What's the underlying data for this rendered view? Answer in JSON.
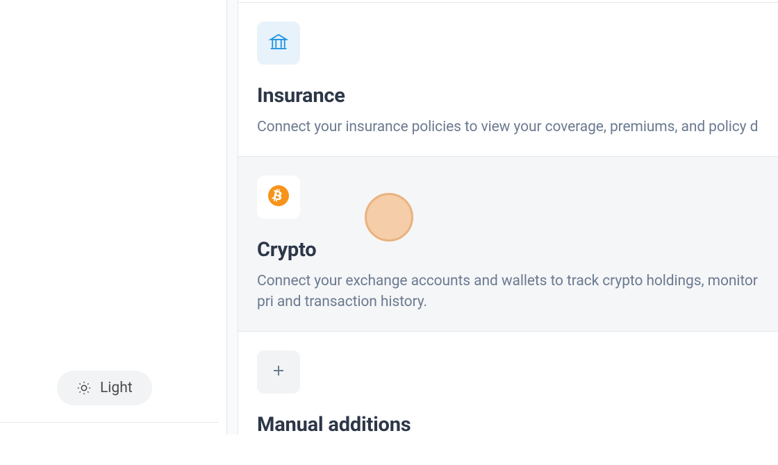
{
  "sidebar": {
    "theme_label": "Light"
  },
  "cards": [
    {
      "title": "Insurance",
      "description": "Connect your insurance policies to view your coverage, premiums, and policy deta"
    },
    {
      "title": "Crypto",
      "description": "Connect your exchange accounts and wallets to track crypto holdings, monitor pri and transaction history."
    },
    {
      "title": "Manual additions",
      "description": ""
    }
  ]
}
